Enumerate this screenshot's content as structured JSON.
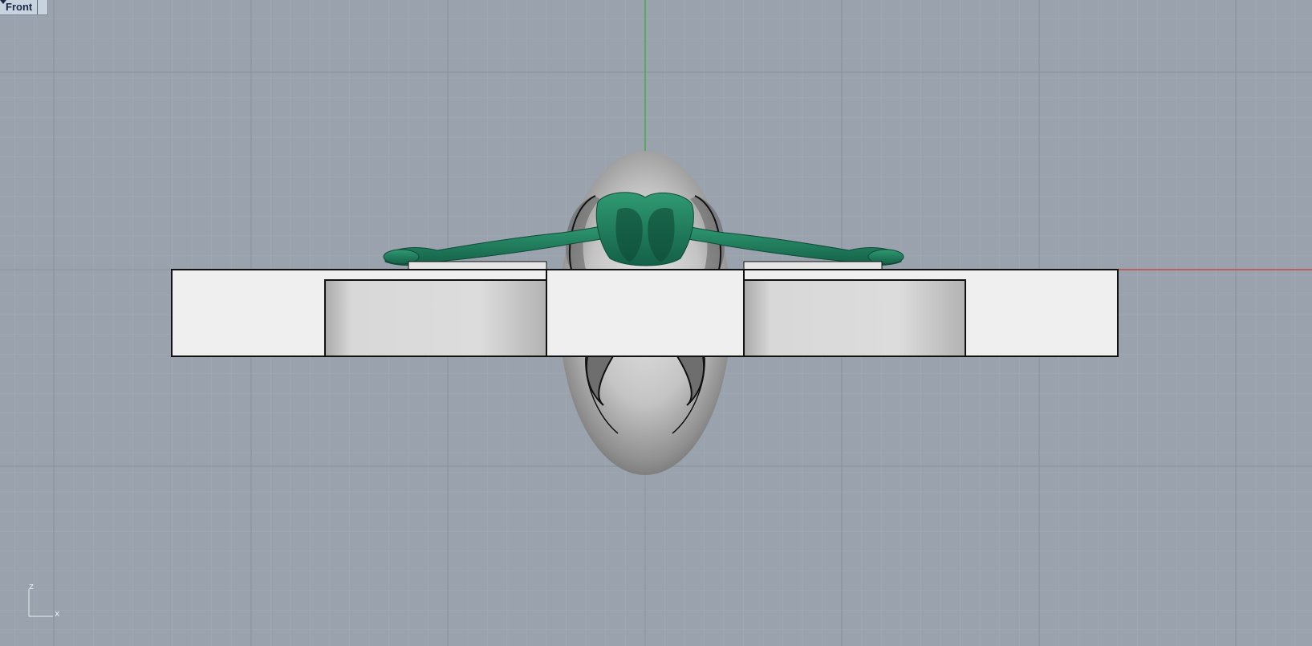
{
  "viewport": {
    "title": "Front",
    "menu_icon": "chevron-down-icon"
  },
  "axis_gizmo": {
    "vertical_label": "z",
    "horizontal_label": "x"
  },
  "colors": {
    "background": "#9aa3ad",
    "grid_minor": "#a3abb4",
    "grid_major": "#8b949e",
    "x_axis": "#c44a4a",
    "z_axis": "#3fae3f",
    "figure": "#1f7a5a",
    "body_shading": "#d6d6d6",
    "base_fill": "#efefef"
  }
}
